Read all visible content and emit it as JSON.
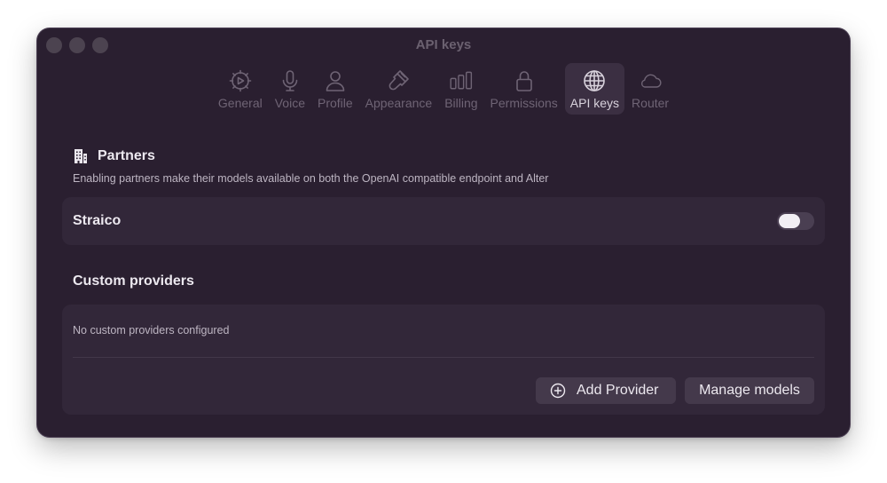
{
  "window": {
    "title": "API keys"
  },
  "tabs": [
    {
      "label": "General",
      "icon": "gear-play-icon",
      "active": false
    },
    {
      "label": "Voice",
      "icon": "microphone-icon",
      "active": false
    },
    {
      "label": "Profile",
      "icon": "person-icon",
      "active": false
    },
    {
      "label": "Appearance",
      "icon": "paintbrush-icon",
      "active": false
    },
    {
      "label": "Billing",
      "icon": "bar-chart-icon",
      "active": false
    },
    {
      "label": "Permissions",
      "icon": "lock-icon",
      "active": false
    },
    {
      "label": "API keys",
      "icon": "globe-icon",
      "active": true
    },
    {
      "label": "Router",
      "icon": "cloud-icon",
      "active": false
    }
  ],
  "partners": {
    "title": "Partners",
    "icon": "building-icon",
    "subtitle": "Enabling partners make their models available on both the OpenAI compatible endpoint and Alter",
    "items": [
      {
        "name": "Straico",
        "enabled": false
      }
    ]
  },
  "custom_providers": {
    "title": "Custom providers",
    "empty_text": "No custom providers configured",
    "add_button": "Add Provider",
    "add_icon": "plus-circle-icon",
    "manage_button": "Manage models"
  },
  "colors": {
    "window_bg": "#2a1f30",
    "card_bg": "#322739",
    "button_bg": "#44394b",
    "text_primary": "#ece8ef",
    "text_muted": "#6f6475"
  }
}
